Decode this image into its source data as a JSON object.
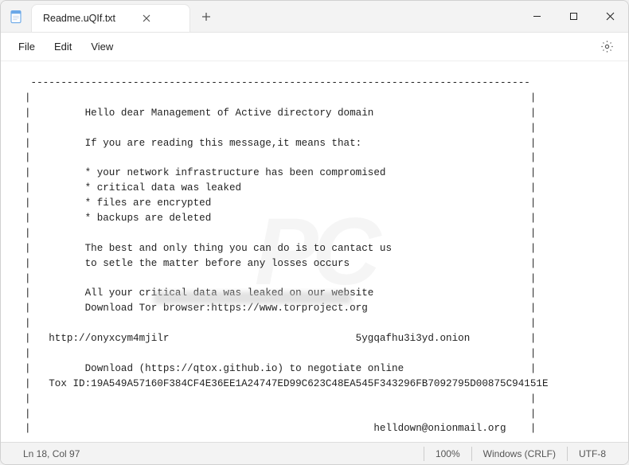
{
  "tab": {
    "title": "Readme.uQIf.txt"
  },
  "menu": {
    "file": "File",
    "edit": "Edit",
    "view": "View"
  },
  "note": {
    "border_top": " -----------------------------------------------------------------------------------",
    "l1": "|                                                                                   |",
    "l2": "|         Hello dear Management of Active directory domain                          |",
    "l3": "|                                                                                   |",
    "l4": "|         If you are reading this message,it means that:                            |",
    "l5": "|                                                                                   |",
    "l6": "|         * your network infrastructure has been compromised                        |",
    "l7": "|         * critical data was leaked                                                |",
    "l8": "|         * files are encrypted                                                     |",
    "l9": "|         * backups are deleted                                                     |",
    "l10": "|                                                                                   |",
    "l11": "|         The best and only thing you can do is to cantact us                       |",
    "l12": "|         to setle the matter before any losses occurs                              |",
    "l13": "|                                                                                   |",
    "l14": "|         All your critical data was leaked on our website                          |",
    "l15": "|         Download Tor browser:https://www.torproject.org                           |",
    "l16": "|                                                                                   |",
    "l17": "|   http://onyxcym4mjilr                               5ygqafhu3i3yd.onion          |",
    "l18": "|                                                                                   |",
    "l19": "|         Download (https://qtox.github.io) to negotiate online                     |",
    "l20": "|   Tox ID:19A549A57160F384CF4E36EE1A24747ED99C623C48EA545F343296FB7092795D00875C94151E",
    "l21": "|                                                                                   |",
    "l22": "|                                                                                   |",
    "l23": "|                                                         helldown@onionmail.org    |",
    "border_bottom": " -----------------------------------------------------------------------------------"
  },
  "status": {
    "position": "Ln 18, Col 97",
    "zoom": "100%",
    "line_ending": "Windows (CRLF)",
    "encoding": "UTF-8"
  }
}
